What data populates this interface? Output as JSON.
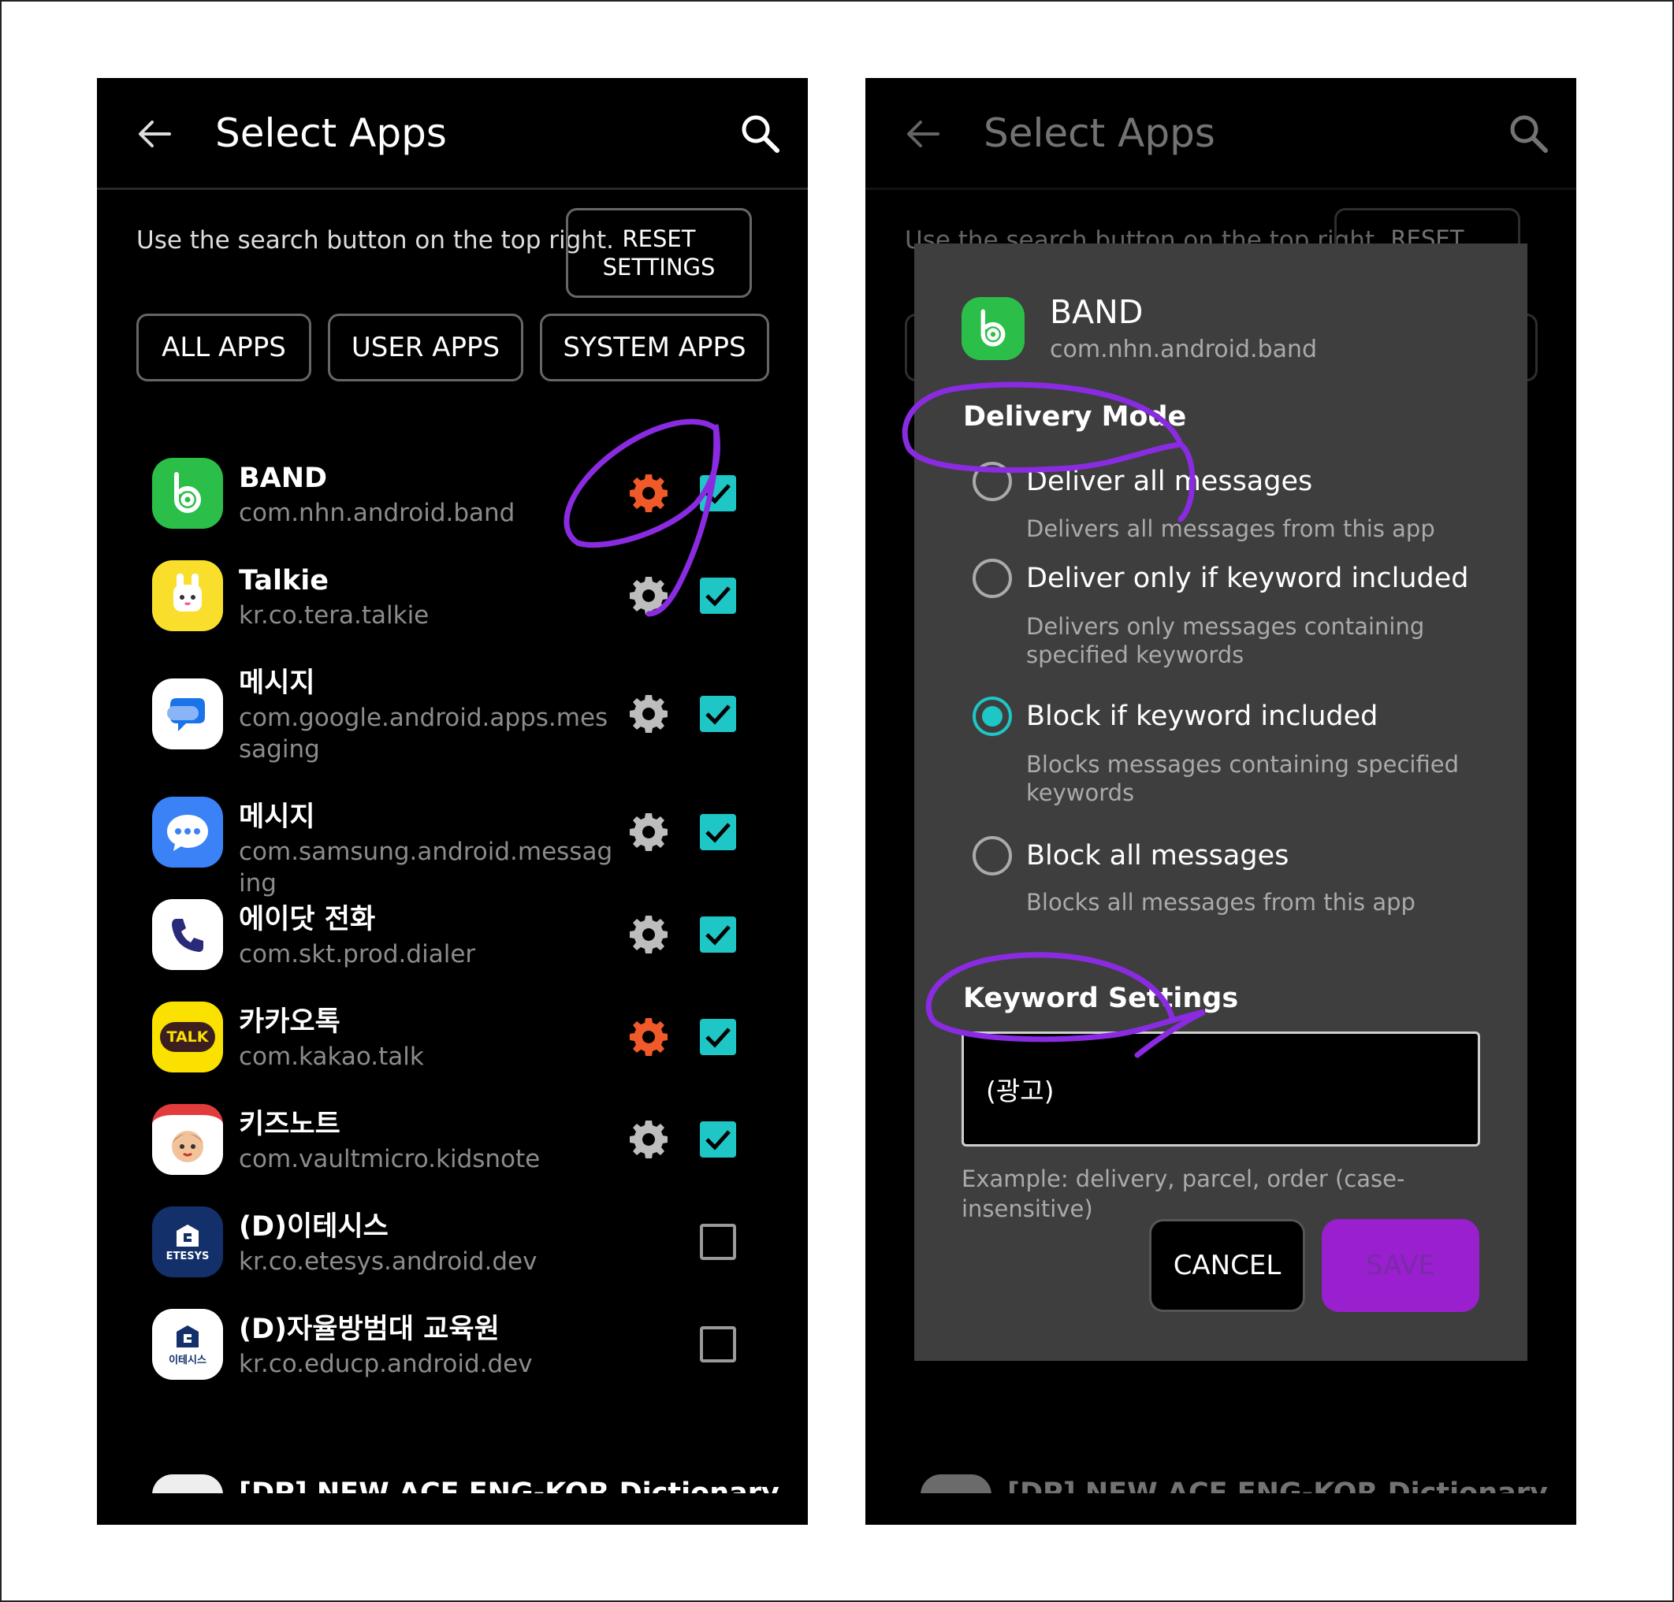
{
  "appbar": {
    "title": "Select Apps"
  },
  "hint": "Use the search button on the top right.",
  "reset_label": "RESET SETTINGS",
  "filters": {
    "all": "ALL APPS",
    "user": "USER APPS",
    "system": "SYSTEM APPS"
  },
  "apps": [
    {
      "name": "BAND",
      "pkg": "com.nhn.android.band",
      "gear": "orange",
      "checked": true
    },
    {
      "name": "Talkie",
      "pkg": "kr.co.tera.talkie",
      "gear": "gray",
      "checked": true
    },
    {
      "name": "메시지",
      "pkg": "com.google.android.apps.messaging",
      "gear": "gray",
      "checked": true
    },
    {
      "name": "메시지",
      "pkg": "com.samsung.android.messaging",
      "gear": "gray",
      "checked": true
    },
    {
      "name": "에이닷 전화",
      "pkg": "com.skt.prod.dialer",
      "gear": "gray",
      "checked": true
    },
    {
      "name": "카카오톡",
      "pkg": "com.kakao.talk",
      "gear": "orange",
      "checked": true
    },
    {
      "name": "키즈노트",
      "pkg": "com.vaultmicro.kidsnote",
      "gear": "gray",
      "checked": true
    },
    {
      "name": "(D)이테시스",
      "pkg": "kr.co.etesys.android.dev",
      "gear": "none",
      "checked": false
    },
    {
      "name": "(D)자율방범대 교육원",
      "pkg": "kr.co.educp.android.dev",
      "gear": "none",
      "checked": false
    },
    {
      "name": "[DP] NEW ACE ENG-KOR Dictionary",
      "pkg": "",
      "gear": "none",
      "checked": false
    }
  ],
  "icon_texts": {
    "kakao": "TALK",
    "etesys": "ETESYS",
    "educp": "이테시스"
  },
  "dialog": {
    "app_name": "BAND",
    "app_pkg": "com.nhn.android.band",
    "delivery_title": "Delivery Mode",
    "options": [
      {
        "label": "Deliver all messages",
        "desc": "Delivers all messages from this app",
        "selected": false
      },
      {
        "label": "Deliver only if keyword included",
        "desc": "Delivers only messages containing specified keywords",
        "selected": false
      },
      {
        "label": "Block if keyword included",
        "desc": "Blocks messages containing specified keywords",
        "selected": true
      },
      {
        "label": "Block all messages",
        "desc": "Blocks all messages from this app",
        "selected": false
      }
    ],
    "keyword_title": "Keyword Settings",
    "keyword_value": "(광고)",
    "keyword_example": "Example: delivery, parcel, order (case-insensitive)",
    "cancel": "CANCEL",
    "save": "SAVE"
  },
  "colors": {
    "accent": "#1ec6c6",
    "orange_gear": "#f05a28",
    "gray_gear": "#bdbdbd",
    "annotation": "#8a2be2",
    "save_bg": "#9a1fcf"
  }
}
